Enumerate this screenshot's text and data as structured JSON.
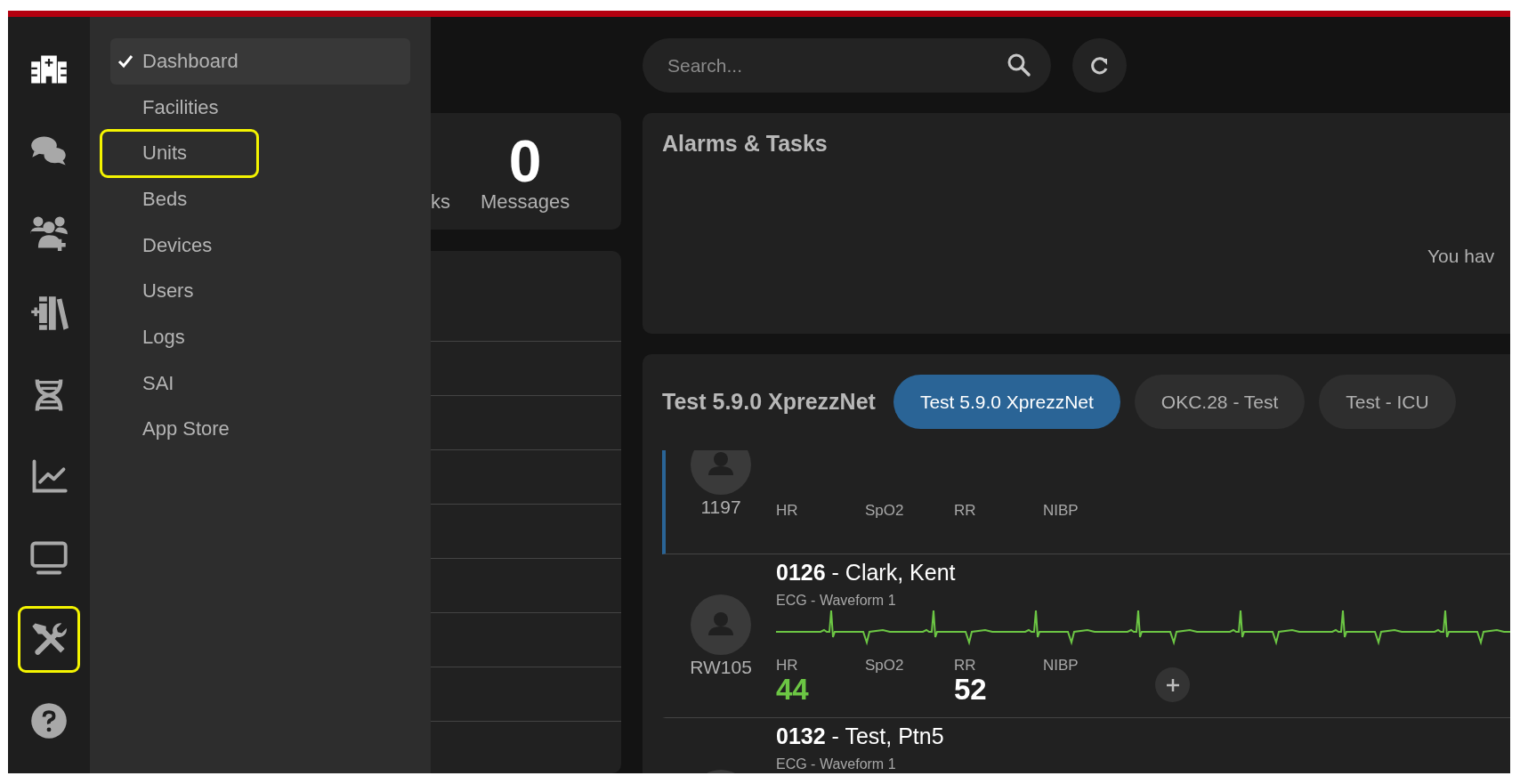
{
  "rail": [
    {
      "selected": true,
      "highlighted": false
    },
    {
      "selected": false,
      "highlighted": false
    },
    {
      "selected": false,
      "highlighted": false
    },
    {
      "selected": false,
      "highlighted": false
    },
    {
      "selected": false,
      "highlighted": false
    },
    {
      "selected": false,
      "highlighted": false
    },
    {
      "selected": false,
      "highlighted": false
    },
    {
      "selected": false,
      "highlighted": true
    },
    {
      "selected": false,
      "highlighted": false
    }
  ],
  "menu": [
    {
      "label": "Dashboard",
      "selected": true,
      "highlighted": false
    },
    {
      "label": "Facilities",
      "selected": false,
      "highlighted": false
    },
    {
      "label": "Units",
      "selected": false,
      "highlighted": true
    },
    {
      "label": "Beds",
      "selected": false,
      "highlighted": false
    },
    {
      "label": "Devices",
      "selected": false,
      "highlighted": false
    },
    {
      "label": "Users",
      "selected": false,
      "highlighted": false
    },
    {
      "label": "Logs",
      "selected": false,
      "highlighted": false
    },
    {
      "label": "SAI",
      "selected": false,
      "highlighted": false
    },
    {
      "label": "App Store",
      "selected": false,
      "highlighted": false
    }
  ],
  "stats": [
    {
      "label": "ks"
    },
    {
      "value": "0",
      "label": "Messages"
    }
  ],
  "search": {
    "placeholder": "Search..."
  },
  "alarms": {
    "title": "Alarms & Tasks",
    "message": "You hav"
  },
  "unit": {
    "title": "Test 5.9.0 XprezzNet",
    "tabs": [
      {
        "label": "Test 5.9.0 XprezzNet",
        "selected": true
      },
      {
        "label": "OKC.28 - Test",
        "selected": false
      },
      {
        "label": "Test - ICU",
        "selected": false
      }
    ],
    "patients": [
      {
        "id": "1197",
        "selected": true,
        "vitals": [
          {
            "label": "HR"
          },
          {
            "label": "SpO2"
          },
          {
            "label": "RR"
          },
          {
            "label": "NIBP"
          }
        ]
      },
      {
        "id": "RW105",
        "selected": false,
        "name": "**0126** - Clark, Kent",
        "waveform": "ECG - Waveform 1",
        "vitals": [
          {
            "label": "HR",
            "value": "44",
            "color": "#6cc644"
          },
          {
            "label": "SpO2"
          },
          {
            "label": "RR",
            "value": "52",
            "color": "#ffffff"
          },
          {
            "label": "NIBP"
          }
        ]
      },
      {
        "selected": false,
        "name": "**0132** - Test, Ptn5",
        "waveform": "ECG - Waveform 1"
      }
    ]
  }
}
